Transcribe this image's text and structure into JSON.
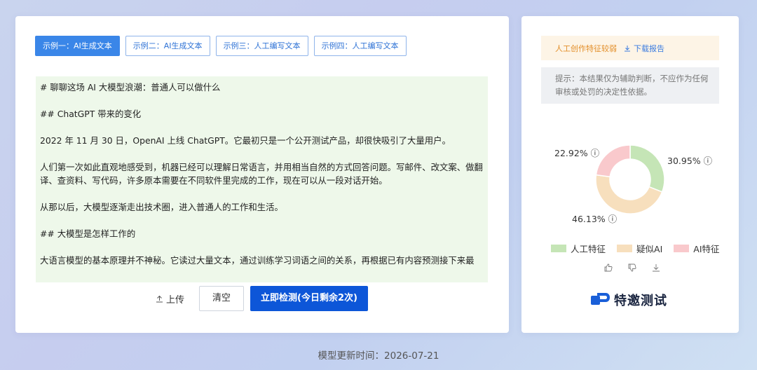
{
  "tabs": [
    {
      "label": "示例一：AI生成文本",
      "active": true
    },
    {
      "label": "示例二：AI生成文本",
      "active": false
    },
    {
      "label": "示例三：人工编写文本",
      "active": false
    },
    {
      "label": "示例四：人工编写文本",
      "active": false
    }
  ],
  "text": {
    "lines": [
      "# 聊聊这场 AI 大模型浪潮：普通人可以做什么",
      "## ChatGPT 带来的变化",
      "2022 年 11 月 30 日，OpenAI 上线 ChatGPT。它最初只是一个公开测试产品，却很快吸引了大量用户。",
      "人们第一次如此直观地感受到，机器已经可以理解日常语言，并用相当自然的方式回答问题。写邮件、改文案、做翻译、查资料、写代码，许多原本需要在不同软件里完成的工作，现在可以从一段对话开始。",
      "从那以后，大模型逐渐走出技术圈，进入普通人的工作和生活。",
      "## 大模型是怎样工作的",
      "大语言模型的基本原理并不神秘。它读过大量文本，通过训练学习词语之间的关系，再根据已有内容预测接下来最"
    ]
  },
  "actions": {
    "upload_label": "上传",
    "clear_label": "清空",
    "detect_label": "立即检测(今日剩余2次)"
  },
  "result": {
    "verdict": "人工创作特征较弱",
    "download_label": "下载报告",
    "notice": "提示：本结果仅为辅助判断，不应作为任何审核或处罚的决定性依据。",
    "close_icon": "×"
  },
  "chart_data": {
    "type": "pie",
    "donut": true,
    "series": [
      {
        "name": "人工特征",
        "value": 30.95,
        "label": "30.95%",
        "color": "#c5e5b6"
      },
      {
        "name": "疑似AI",
        "value": 46.13,
        "label": "46.13%",
        "color": "#f7dfbd"
      },
      {
        "name": "AI特征",
        "value": 22.92,
        "label": "22.92%",
        "color": "#f9c9cc"
      }
    ]
  },
  "legend": [
    "人工特征",
    "疑似AI",
    "AI特征"
  ],
  "brand": {
    "name": "特邀测试"
  },
  "footer": {
    "text": "模型更新时间：2026-07-21"
  }
}
